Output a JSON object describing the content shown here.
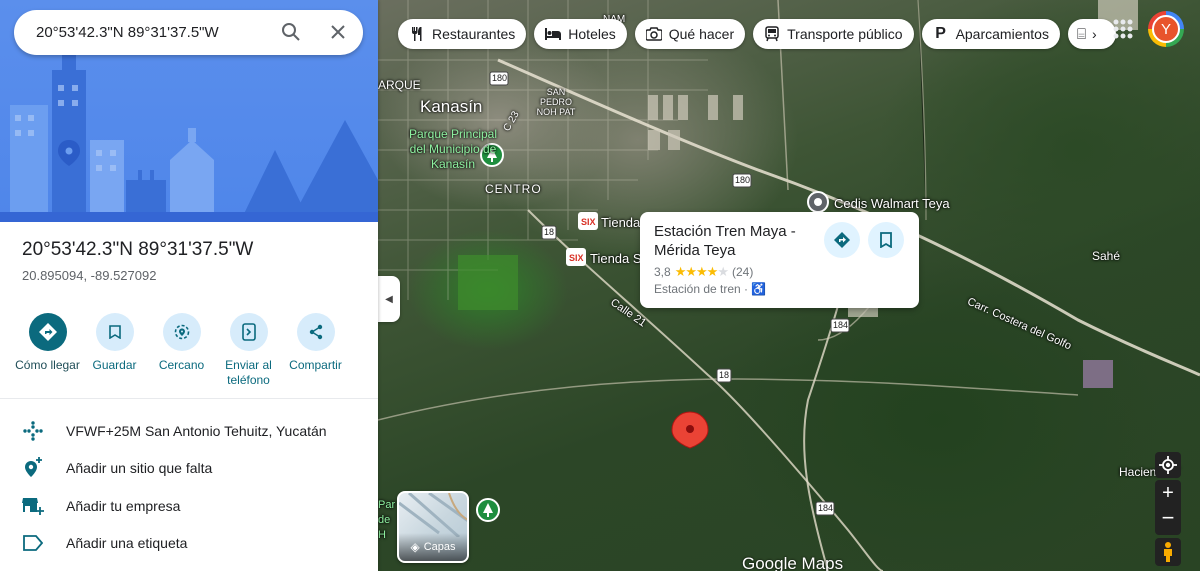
{
  "search": {
    "value": "20°53'42.3\"N 89°31'37.5\"W",
    "search_icon": "search-icon",
    "close_icon": "close-icon"
  },
  "place": {
    "name": "20°53'42.3\"N 89°31'37.5\"W",
    "coordinates": "20.895094, -89.527092"
  },
  "actions": [
    {
      "label": "Cómo llegar",
      "icon": "directions-icon"
    },
    {
      "label": "Guardar",
      "icon": "bookmark-icon"
    },
    {
      "label": "Cercano",
      "icon": "nearby-icon"
    },
    {
      "label": "Enviar al teléfono",
      "icon": "send-to-phone-icon"
    },
    {
      "label": "Compartir",
      "icon": "share-icon"
    }
  ],
  "info_rows": [
    {
      "text": "VFWF+25M San Antonio Tehuitz, Yucatán",
      "icon": "plus-code-icon"
    },
    {
      "text": "Añadir un sitio que falta",
      "icon": "add-place-icon"
    },
    {
      "text": "Añadir tu empresa",
      "icon": "add-business-icon"
    },
    {
      "text": "Añadir una etiqueta",
      "icon": "label-icon"
    }
  ],
  "chips": [
    {
      "label": "Restaurantes",
      "icon": "restaurant-icon"
    },
    {
      "label": "Hoteles",
      "icon": "hotel-icon"
    },
    {
      "label": "Qué hacer",
      "icon": "camera-icon"
    },
    {
      "label": "Transporte público",
      "icon": "transit-icon"
    },
    {
      "label": "Aparcamientos",
      "icon": "parking-icon"
    }
  ],
  "account": {
    "initial": "Y"
  },
  "popup": {
    "title": "Estación Tren Maya - Mérida Teya",
    "rating": "3,8",
    "stars_filled": 4,
    "reviews": "(24)",
    "type": "Estación de tren ·"
  },
  "map_labels": {
    "kanasin": "Kanasín",
    "parque": "Parque Principal del Municipio de Kanasín",
    "centro": "CENTRO",
    "san_pedro": "SAN PEDRO NOH PAT",
    "tienda1": "Tienda",
    "tienda2": "Tienda S",
    "calle21": "Calle 21",
    "cedis": "Cedis Walmart Teya",
    "sahe": "Sahé",
    "carretera": "Carr. Costera del Golfo",
    "hacienda": "Hacienda T",
    "parque_left": "Par de H",
    "arque": "ARQUE",
    "nam": "NAM",
    "route_180a": "180",
    "route_180b": "180",
    "route_18a": "18",
    "route_18b": "18",
    "route_184a": "184",
    "route_184b": "184",
    "route_c23": "C 23",
    "google_maps": "Google Maps",
    "layers": "Capas"
  }
}
